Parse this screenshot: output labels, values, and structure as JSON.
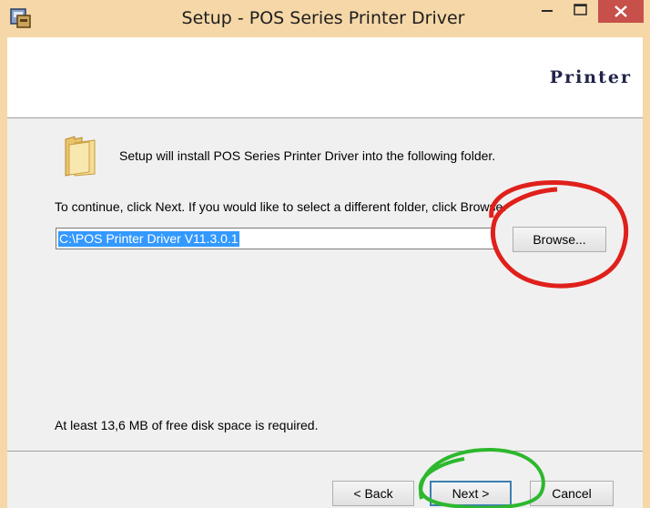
{
  "window": {
    "title": "Setup - POS Series Printer Driver",
    "title_bar_color": "#f6d7a7",
    "close_color": "#c7504a"
  },
  "header": {
    "brand": "Printer"
  },
  "main": {
    "intro_text": "Setup will install POS Series Printer Driver into the following folder.",
    "instruction_text": "To continue, click Next. If you would like to select a different folder, click Browse.",
    "path_value": "C:\\POS Printer Driver V11.3.0.1",
    "browse_label": "Browse...",
    "space_text": "At least 13,6 MB of free disk space is required."
  },
  "footer": {
    "back_label": "< Back",
    "next_label": "Next >",
    "cancel_label": "Cancel"
  },
  "annotations": {
    "browse_circle_color": "#e0201b",
    "next_circle_color": "#2db82d"
  },
  "icons": [
    "app-setup-icon",
    "minimize-icon",
    "maximize-icon",
    "close-icon",
    "folder-icon"
  ]
}
